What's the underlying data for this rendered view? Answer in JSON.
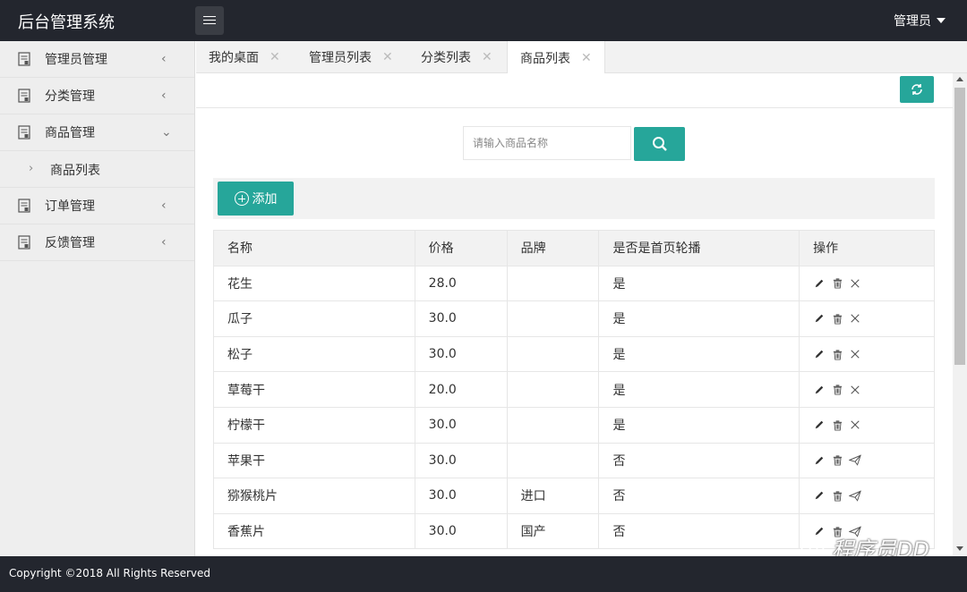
{
  "header": {
    "title": "后台管理系统",
    "user_label": "管理员"
  },
  "sidebar": {
    "items": [
      {
        "label": "管理员管理",
        "arrow": "‹"
      },
      {
        "label": "分类管理",
        "arrow": "‹"
      },
      {
        "label": "商品管理",
        "arrow": "⌄"
      },
      {
        "label": "订单管理",
        "arrow": "‹"
      },
      {
        "label": "反馈管理",
        "arrow": "‹"
      }
    ],
    "sub_items": [
      {
        "label": "商品列表",
        "chevron": "›"
      }
    ]
  },
  "tabs": [
    {
      "label": "我的桌面",
      "close": "✕"
    },
    {
      "label": "管理员列表",
      "close": "✕"
    },
    {
      "label": "分类列表",
      "close": "✕"
    },
    {
      "label": "商品列表",
      "close": "✕"
    }
  ],
  "search": {
    "placeholder": "请输入商品名称",
    "value": ""
  },
  "actions": {
    "add_label": "添加"
  },
  "table": {
    "headers": [
      "名称",
      "价格",
      "品牌",
      "是否是首页轮播",
      "操作"
    ],
    "rows": [
      {
        "name": "花生",
        "price": "28.0",
        "brand": "",
        "carousel": "是",
        "third_op": "close-icon"
      },
      {
        "name": "瓜子",
        "price": "30.0",
        "brand": "",
        "carousel": "是",
        "third_op": "close-icon"
      },
      {
        "name": "松子",
        "price": "30.0",
        "brand": "",
        "carousel": "是",
        "third_op": "close-icon"
      },
      {
        "name": "草莓干",
        "price": "20.0",
        "brand": "",
        "carousel": "是",
        "third_op": "close-icon"
      },
      {
        "name": "柠檬干",
        "price": "30.0",
        "brand": "",
        "carousel": "是",
        "third_op": "close-icon"
      },
      {
        "name": "苹果干",
        "price": "30.0",
        "brand": "",
        "carousel": "否",
        "third_op": "send-icon"
      },
      {
        "name": "猕猴桃片",
        "price": "30.0",
        "brand": "进口",
        "carousel": "否",
        "third_op": "send-icon"
      },
      {
        "name": "香蕉片",
        "price": "30.0",
        "brand": "国产",
        "carousel": "否",
        "third_op": "send-icon"
      }
    ]
  },
  "watermark": {
    "text": "程序员DD"
  },
  "footer": {
    "copyright": "Copyright ©2018 All Rights Reserved"
  },
  "colors": {
    "header_bg": "#23262e",
    "accent": "#26a69a",
    "sidebar_bg": "#eeeeee"
  }
}
